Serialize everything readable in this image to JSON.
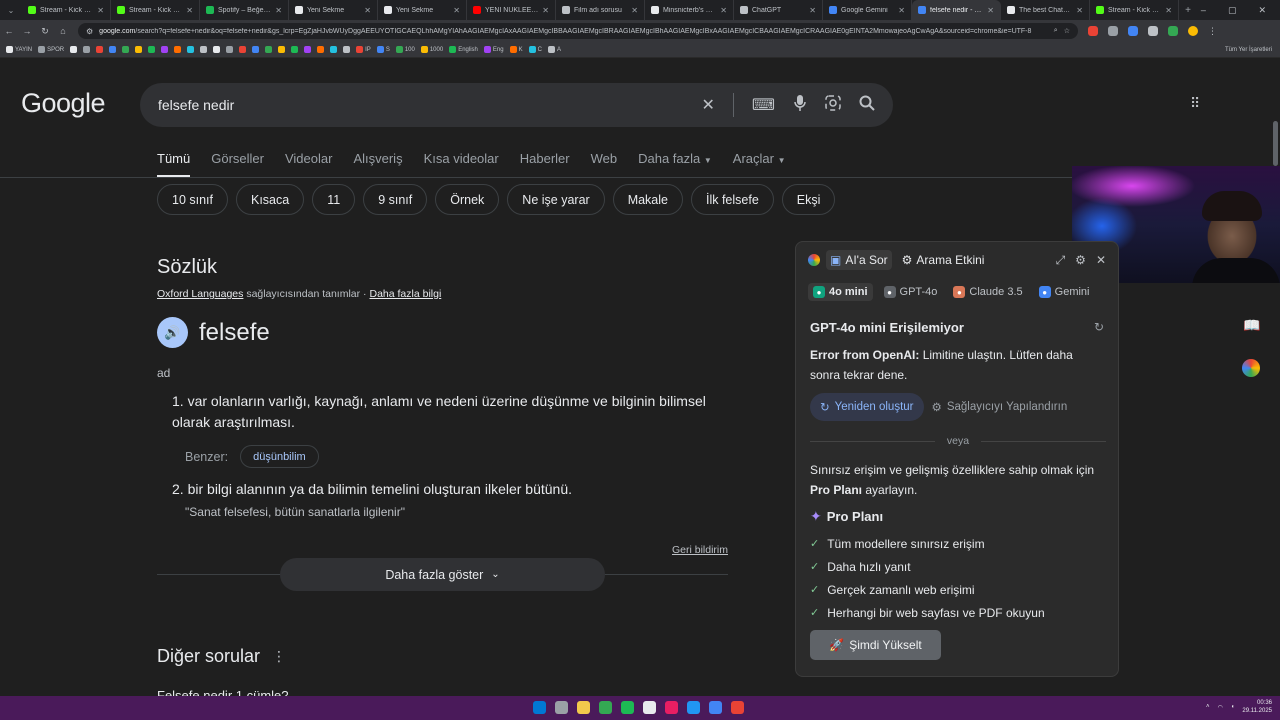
{
  "tabs": [
    {
      "title": "Stream - Kick Dashb",
      "color": "#53fc18"
    },
    {
      "title": "Stream - Kick Dashb",
      "color": "#53fc18"
    },
    {
      "title": "Spotify – Beğenilen",
      "color": "#1db954"
    },
    {
      "title": "Yeni Sekme",
      "color": "#e8eaed"
    },
    {
      "title": "Yeni Sekme",
      "color": "#e8eaed"
    },
    {
      "title": "YENİ NÜKLEER SAN",
      "color": "#ff0000"
    },
    {
      "title": "Film adı sorusu",
      "color": "#bdc1c6"
    },
    {
      "title": "Minsnicterb's profil",
      "color": "#e8eaed"
    },
    {
      "title": "ChatGPT",
      "color": "#bdc1c6"
    },
    {
      "title": "Google Gemini",
      "color": "#4285f4"
    },
    {
      "title": "felsefe nedir - Goog",
      "color": "#4285f4"
    },
    {
      "title": "The best ChatBot a",
      "color": "#e8eaed"
    },
    {
      "title": "Stream - Kick Dashb",
      "color": "#53fc18"
    }
  ],
  "active_tab_index": 10,
  "omnibox": {
    "host": "google.com",
    "path": "/search?q=felsefe+nedir&oq=felsefe+nedir&gs_lcrp=EgZjaHJvbWUyDggAEEUYOTIGCAEQLhhAMgYIAhAAGIAEMgcIAxAAGIAEMgcIBBAAGIAEMgcIBRAAGIAEMgcIBhAAGIAEMgcIBxAAGIAEMgcICBAAGIAEMgcICRAAGIAE0gEINTA2MmowajeoAgCwAgA&sourceid=chrome&ie=UTF-8"
  },
  "bookmarks": [
    "YAYIN",
    "SPOR",
    "IP",
    "S",
    "100",
    "1000",
    "English",
    "Eng",
    "K",
    "C",
    "A"
  ],
  "bookmarks_right": "Tüm Yer İşaretleri",
  "search": {
    "logo": "Google",
    "query": "felsefe nedir"
  },
  "filters": [
    {
      "label": "Tümü",
      "active": true
    },
    {
      "label": "Görseller"
    },
    {
      "label": "Videolar"
    },
    {
      "label": "Alışveriş"
    },
    {
      "label": "Kısa videolar"
    },
    {
      "label": "Haberler"
    },
    {
      "label": "Web"
    },
    {
      "label": "Daha fazla",
      "caret": true
    },
    {
      "label": "Araçlar",
      "caret": true
    }
  ],
  "chips": [
    "10 sınıf",
    "Kısaca",
    "11",
    "9 sınıf",
    "Örnek",
    "Ne işe yarar",
    "Makale",
    "İlk felsefe",
    "Ekşi"
  ],
  "dictionary": {
    "title": "Sözlük",
    "provider": "Oxford Languages",
    "provider_suffix": "sağlayıcısından tanımlar",
    "more_info": "Daha fazla bilgi",
    "word": "felsefe",
    "pos": "ad",
    "def1_num": "1.",
    "def1": "var olanların varlığı, kaynağı, anlamı ve nedeni üzerine düşünme ve bilginin bilimsel olarak araştırılması.",
    "similar_label": "Benzer:",
    "similar_word": "düşünbilim",
    "def2_num": "2.",
    "def2": "bir bilgi alanının ya da bilimin temelini oluşturan ilkeler bütünü.",
    "example": "\"Sanat felsefesi, bütün sanatlarla ilgilenir\"",
    "feedback": "Geri bildirim",
    "show_more": "Daha fazla göster"
  },
  "other_questions": {
    "title": "Diğer sorular",
    "first": "Felsefe nedir 1 cümle?"
  },
  "sidepanel": {
    "tab_ask": "AI'a Sor",
    "tab_search": "Arama Etkini",
    "models": [
      {
        "label": "4o mini",
        "active": true,
        "color": "#10a37f"
      },
      {
        "label": "GPT-4o",
        "color": "#5f6368"
      },
      {
        "label": "Claude 3.5",
        "color": "#d97757"
      },
      {
        "label": "Gemini",
        "color": "#4285f4"
      }
    ],
    "title": "GPT-4o mini Erişilemiyor",
    "error_prefix": "Error from OpenAI:",
    "error_text": "Limitine ulaştın. Lütfen daha sonra tekrar dene.",
    "regen": "Yeniden oluştur",
    "configure": "Sağlayıcıyı Yapılandırın",
    "or": "veya",
    "promo_text": "Sınırsız erişim ve gelişmiş özelliklere sahip olmak için",
    "promo_bold": "Pro Planı",
    "promo_suffix": "ayarlayın.",
    "pro_title": "Pro Planı",
    "features": [
      "Tüm modellere sınırsız erişim",
      "Daha hızlı yanıt",
      "Gerçek zamanlı web erişimi",
      "Herhangi bir web sayfası ve PDF okuyun"
    ],
    "upgrade": "Şimdi Yükselt"
  },
  "taskbar": {
    "time": "00:36",
    "date": "29.11.2025",
    "icons": [
      "#0078d4",
      "#9aa0a6",
      "#f2c94c",
      "#34a853",
      "#1db954",
      "#e8eaed",
      "#e91e63",
      "#2196f3",
      "#4285f4",
      "#ea4335"
    ]
  }
}
